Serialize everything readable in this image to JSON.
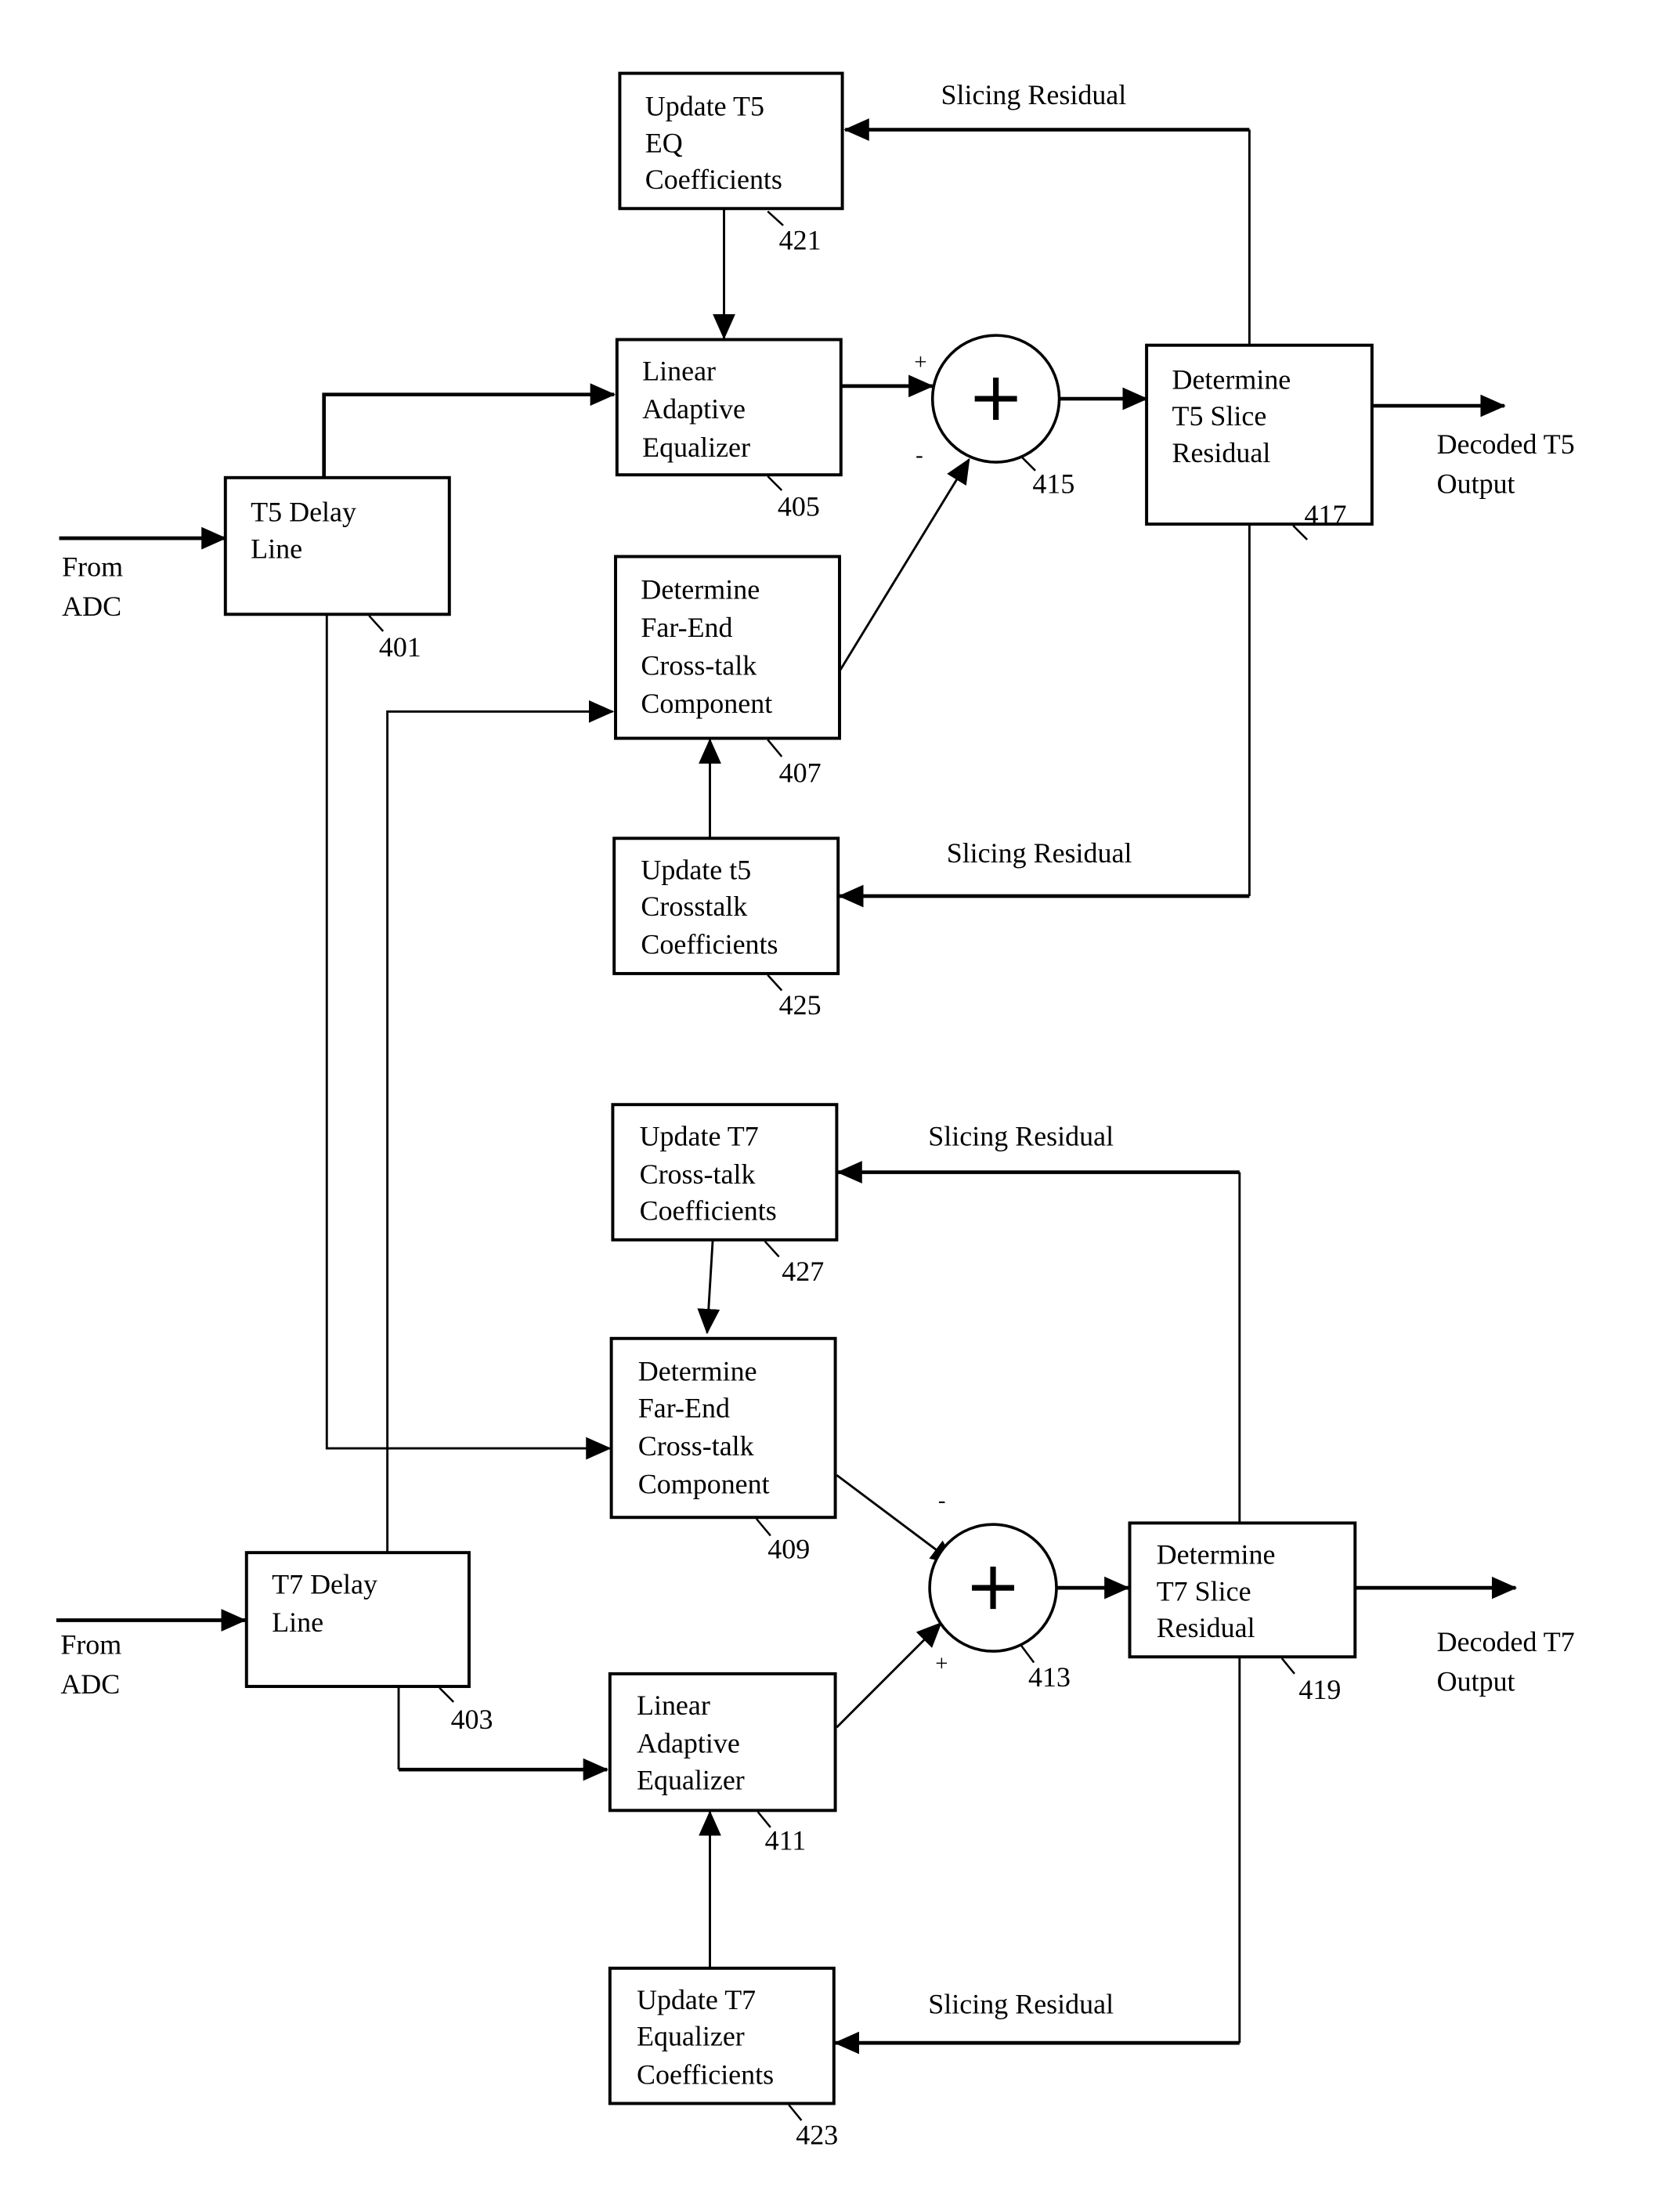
{
  "diagram": {
    "blocks": [
      {
        "id": "421",
        "lines": [
          "Update T5",
          "EQ",
          "Coefficients"
        ]
      },
      {
        "id": "405",
        "lines": [
          "Linear",
          "Adaptive",
          "Equalizer"
        ]
      },
      {
        "id": "401",
        "lines": [
          "T5 Delay",
          "Line"
        ]
      },
      {
        "id": "407",
        "lines": [
          "Determine",
          "Far-End",
          "Cross-talk",
          "Component"
        ]
      },
      {
        "id": "425",
        "lines": [
          "Update t5",
          "Crosstalk",
          "Coefficients"
        ]
      },
      {
        "id": "417",
        "lines": [
          "Determine",
          "T5 Slice",
          "Residual"
        ]
      },
      {
        "id": "427",
        "lines": [
          "Update T7",
          "Cross-talk",
          "Coefficients"
        ]
      },
      {
        "id": "409",
        "lines": [
          "Determine",
          "Far-End",
          "Cross-talk",
          "Component"
        ]
      },
      {
        "id": "403",
        "lines": [
          "T7 Delay",
          "Line"
        ]
      },
      {
        "id": "411",
        "lines": [
          "Linear",
          "Adaptive",
          "Equalizer"
        ]
      },
      {
        "id": "423",
        "lines": [
          "Update T7",
          "Equalizer",
          "Coefficients"
        ]
      },
      {
        "id": "419",
        "lines": [
          "Determine",
          "T7 Slice",
          "Residual"
        ]
      }
    ],
    "summers": [
      {
        "id": "415",
        "top_sign": "+",
        "bottom_sign": "-"
      },
      {
        "id": "413",
        "top_sign": "-",
        "bottom_sign": "+"
      }
    ],
    "labels": {
      "slicing_residual": "Slicing Residual",
      "from_adc_1": [
        "From",
        "ADC"
      ],
      "from_adc_2": [
        "From",
        "ADC"
      ],
      "out_t5": [
        "Decoded T5",
        "Output"
      ],
      "out_t7": [
        "Decoded T7",
        "Output"
      ]
    },
    "refs": [
      "421",
      "405",
      "401",
      "407",
      "425",
      "415",
      "417",
      "427",
      "409",
      "403",
      "411",
      "423",
      "413",
      "419"
    ]
  }
}
